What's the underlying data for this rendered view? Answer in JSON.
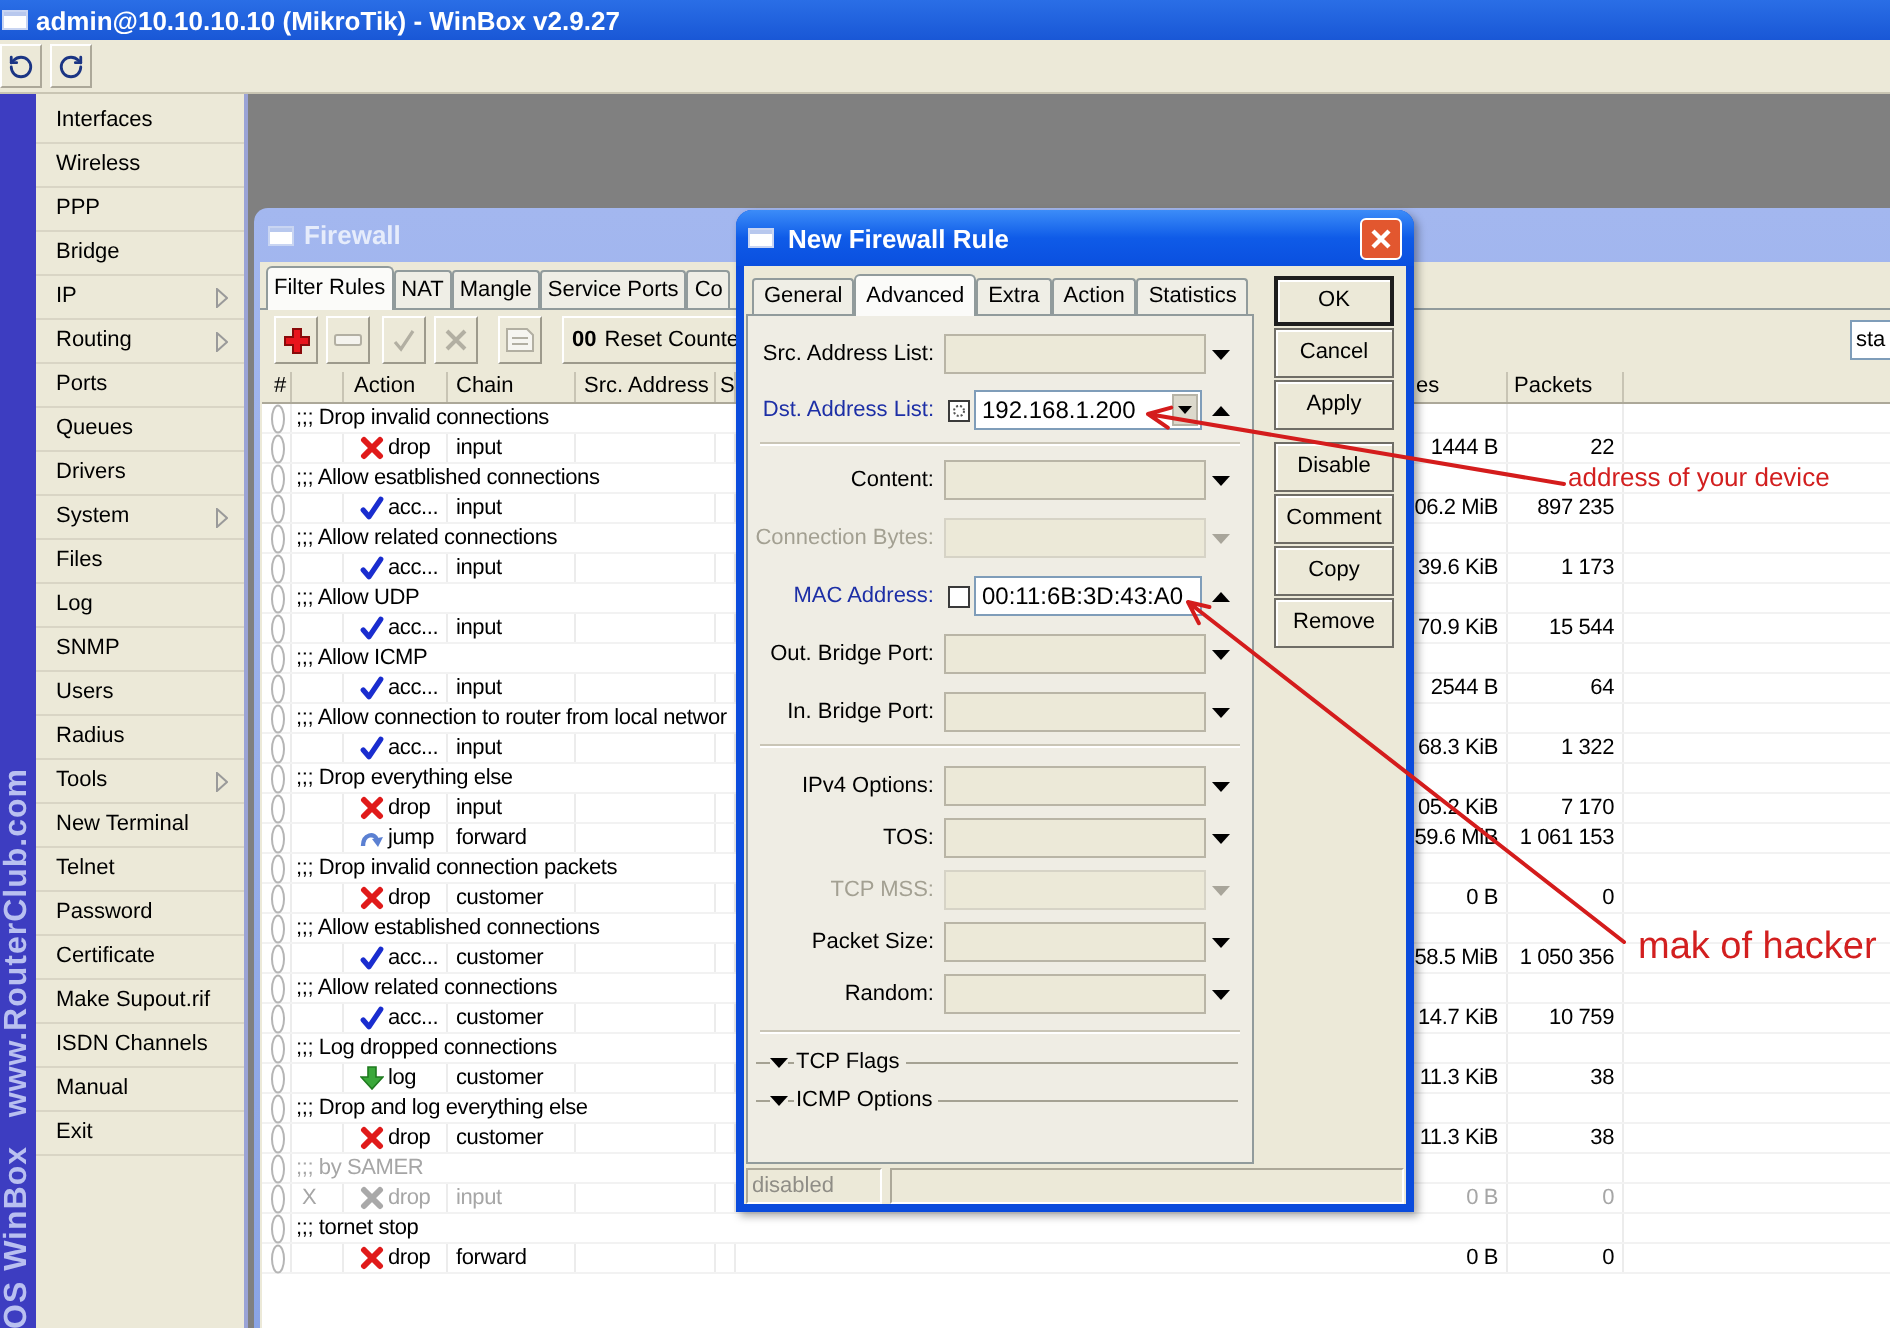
{
  "window": {
    "title": "admin@10.10.10.10 (MikroTik) - WinBox v2.9.27"
  },
  "toolbar": [
    {
      "kind": "undo"
    },
    {
      "kind": "redo"
    }
  ],
  "banner": [
    "OS WinBox",
    "www.RouterClub.com"
  ],
  "sidebar": {
    "items": [
      {
        "label": "Interfaces",
        "submenu": false
      },
      {
        "label": "Wireless",
        "submenu": false
      },
      {
        "label": "PPP",
        "submenu": false
      },
      {
        "label": "Bridge",
        "submenu": false
      },
      {
        "label": "IP",
        "submenu": true
      },
      {
        "label": "Routing",
        "submenu": true
      },
      {
        "label": "Ports",
        "submenu": false
      },
      {
        "label": "Queues",
        "submenu": false
      },
      {
        "label": "Drivers",
        "submenu": false
      },
      {
        "label": "System",
        "submenu": true
      },
      {
        "label": "Files",
        "submenu": false
      },
      {
        "label": "Log",
        "submenu": false
      },
      {
        "label": "SNMP",
        "submenu": false
      },
      {
        "label": "Users",
        "submenu": false
      },
      {
        "label": "Radius",
        "submenu": false
      },
      {
        "label": "Tools",
        "submenu": true
      },
      {
        "label": "New Terminal",
        "submenu": false
      },
      {
        "label": "Telnet",
        "submenu": false
      },
      {
        "label": "Password",
        "submenu": false
      },
      {
        "label": "Certificate",
        "submenu": false
      },
      {
        "label": "Make Supout.rif",
        "submenu": false
      },
      {
        "label": "ISDN Channels",
        "submenu": false
      },
      {
        "label": "Manual",
        "submenu": false
      },
      {
        "label": "Exit",
        "submenu": false
      }
    ]
  },
  "firewall": {
    "title": "Firewall",
    "tabs": [
      {
        "label": "Filter Rules",
        "selected": true
      },
      {
        "label": "NAT",
        "selected": false
      },
      {
        "label": "Mangle",
        "selected": false
      },
      {
        "label": "Service Ports",
        "selected": false
      },
      {
        "label": "Co",
        "selected": false
      }
    ],
    "toolbar": [
      {
        "kind": "add",
        "disabled": false
      },
      {
        "kind": "remove",
        "disabled": true
      },
      {
        "kind": "enable",
        "disabled": true
      },
      {
        "kind": "disable",
        "disabled": true
      },
      {
        "kind": "comment",
        "disabled": true
      }
    ],
    "reset_button": {
      "icon_text": "00",
      "label": "Reset Counte"
    },
    "filter_field": {
      "value": "sta"
    },
    "table": {
      "columns": [
        "#",
        "Action",
        "Chain",
        "Src. Address",
        "S",
        "es",
        "Packets"
      ],
      "rows": [
        {
          "kind": "comment",
          "text": ";;; Drop invalid connections",
          "disabled": false
        },
        {
          "kind": "drop",
          "action": "drop",
          "chain": "input",
          "bytes": "1444 B",
          "packets": "22",
          "disabled": false
        },
        {
          "kind": "comment",
          "text": ";;; Allow esatblished connections",
          "disabled": false
        },
        {
          "kind": "accept",
          "action": "acc...",
          "chain": "input",
          "bytes": "06.2 MiB",
          "packets": "897 235",
          "disabled": false
        },
        {
          "kind": "comment",
          "text": ";;; Allow related connections",
          "disabled": false
        },
        {
          "kind": "accept",
          "action": "acc...",
          "chain": "input",
          "bytes": "39.6 KiB",
          "packets": "1 173",
          "disabled": false
        },
        {
          "kind": "comment",
          "text": ";;; Allow UDP",
          "disabled": false
        },
        {
          "kind": "accept",
          "action": "acc...",
          "chain": "input",
          "bytes": "70.9 KiB",
          "packets": "15 544",
          "disabled": false
        },
        {
          "kind": "comment",
          "text": ";;; Allow ICMP",
          "disabled": false
        },
        {
          "kind": "accept",
          "action": "acc...",
          "chain": "input",
          "bytes": "2544 B",
          "packets": "64",
          "disabled": false
        },
        {
          "kind": "comment",
          "text": ";;; Allow connection to router from local networ",
          "disabled": false
        },
        {
          "kind": "accept",
          "action": "acc...",
          "chain": "input",
          "bytes": "68.3 KiB",
          "packets": "1 322",
          "disabled": false
        },
        {
          "kind": "comment",
          "text": ";;; Drop everything else",
          "disabled": false
        },
        {
          "kind": "drop",
          "action": "drop",
          "chain": "input",
          "bytes": "05.2 KiB",
          "packets": "7 170",
          "disabled": false
        },
        {
          "kind": "jump",
          "action": "jump",
          "chain": "forward",
          "bytes": "59.6 MiB",
          "packets": "1 061 153",
          "disabled": false
        },
        {
          "kind": "comment",
          "text": ";;; Drop invalid connection packets",
          "disabled": false
        },
        {
          "kind": "drop",
          "action": "drop",
          "chain": "customer",
          "bytes": "0 B",
          "packets": "0",
          "disabled": false
        },
        {
          "kind": "comment",
          "text": ";;; Allow established connections",
          "disabled": false
        },
        {
          "kind": "accept",
          "action": "acc...",
          "chain": "customer",
          "bytes": "58.5 MiB",
          "packets": "1 050 356",
          "disabled": false
        },
        {
          "kind": "comment",
          "text": ";;; Allow related connections",
          "disabled": false
        },
        {
          "kind": "accept",
          "action": "acc...",
          "chain": "customer",
          "bytes": "14.7 KiB",
          "packets": "10 759",
          "disabled": false
        },
        {
          "kind": "comment",
          "text": ";;; Log dropped connections",
          "disabled": false
        },
        {
          "kind": "log",
          "action": "log",
          "chain": "customer",
          "bytes": "11.3 KiB",
          "packets": "38",
          "disabled": false
        },
        {
          "kind": "comment",
          "text": ";;; Drop and log everything else",
          "disabled": false
        },
        {
          "kind": "drop",
          "action": "drop",
          "chain": "customer",
          "bytes": "11.3 KiB",
          "packets": "38",
          "disabled": false
        },
        {
          "kind": "comment",
          "text": ";;; by SAMER",
          "disabled": true
        },
        {
          "kind": "drop",
          "flag": "X",
          "action": "drop",
          "chain": "input",
          "bytes": "0 B",
          "packets": "0",
          "disabled": true
        },
        {
          "kind": "comment",
          "text": ";;; tornet stop",
          "disabled": false
        },
        {
          "kind": "drop",
          "action": "drop",
          "chain": "forward",
          "bytes": "0 B",
          "packets": "0",
          "disabled": false
        }
      ]
    }
  },
  "dialog": {
    "title": "New Firewall Rule",
    "tabs": [
      {
        "label": "General",
        "selected": false
      },
      {
        "label": "Advanced",
        "selected": true
      },
      {
        "label": "Extra",
        "selected": false
      },
      {
        "label": "Action",
        "selected": false
      },
      {
        "label": "Statistics",
        "selected": false
      }
    ],
    "sections": [
      [
        {
          "label": "Src. Address List:",
          "expanded": false,
          "disabled": false
        },
        {
          "label": "Dst. Address List:",
          "expanded": true,
          "disabled": false,
          "value": "192.168.1.200",
          "negated": false,
          "focused": true,
          "list_button": true
        }
      ],
      [
        {
          "label": "Content:",
          "expanded": false,
          "disabled": false
        },
        {
          "label": "Connection Bytes:",
          "expanded": false,
          "disabled": true
        },
        {
          "label": "MAC Address:",
          "expanded": true,
          "disabled": false,
          "value": "00:11:6B:3D:43:A0",
          "negated": false,
          "focused": false,
          "list_button": false
        },
        {
          "label": "Out. Bridge Port:",
          "expanded": false,
          "disabled": false
        },
        {
          "label": "In. Bridge Port:",
          "expanded": false,
          "disabled": false
        }
      ],
      [
        {
          "label": "IPv4 Options:",
          "expanded": false,
          "disabled": false
        },
        {
          "label": "TOS:",
          "expanded": false,
          "disabled": false
        },
        {
          "label": "TCP MSS:",
          "expanded": false,
          "disabled": true
        },
        {
          "label": "Packet Size:",
          "expanded": false,
          "disabled": false
        },
        {
          "label": "Random:",
          "expanded": false,
          "disabled": false
        }
      ]
    ],
    "collapsibles": [
      {
        "label": "TCP Flags",
        "expanded": false
      },
      {
        "label": "ICMP Options",
        "expanded": false
      }
    ],
    "button_groups": [
      [
        {
          "label": "OK",
          "default": true
        },
        {
          "label": "Cancel",
          "default": false
        },
        {
          "label": "Apply",
          "default": false
        }
      ],
      [
        {
          "label": "Disable",
          "default": false
        },
        {
          "label": "Comment",
          "default": false
        },
        {
          "label": "Copy",
          "default": false
        },
        {
          "label": "Remove",
          "default": false
        }
      ]
    ],
    "status": "disabled"
  },
  "annotations": [
    {
      "text": "address of your device"
    },
    {
      "text": "mak of hacker"
    }
  ]
}
